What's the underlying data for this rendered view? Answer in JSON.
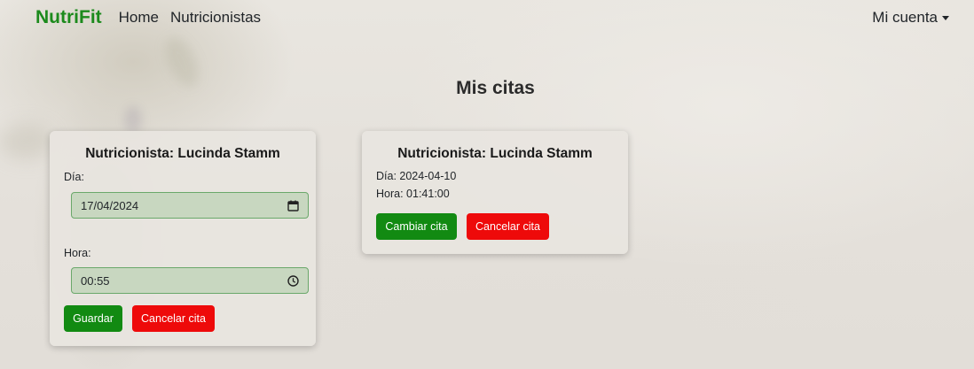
{
  "navbar": {
    "brand": "NutriFit",
    "links": [
      "Home",
      "Nutricionistas"
    ],
    "account_label": "Mi cuenta"
  },
  "page_title": "Mis citas",
  "cards": [
    {
      "title": "Nutricionista: Lucinda Stamm",
      "day_label": "Día:",
      "day_value": "17/04/2024",
      "time_label": "Hora:",
      "time_value": "00:55",
      "save_label": "Guardar",
      "cancel_label": "Cancelar cita"
    },
    {
      "title": "Nutricionista: Lucinda Stamm",
      "day_text": "Día: 2024-04-10",
      "time_text": "Hora: 01:41:00",
      "change_label": "Cambiar cita",
      "cancel_label": "Cancelar cita"
    }
  ],
  "colors": {
    "brand": "#1c8a1c",
    "primary_button": "#128a12",
    "danger_button": "#ee0a0a",
    "input_bg": "#c8d7c0",
    "input_border": "#6aa86a"
  },
  "icons": {
    "date": "calendar-icon",
    "time": "clock-icon",
    "dropdown": "caret-down-icon"
  }
}
